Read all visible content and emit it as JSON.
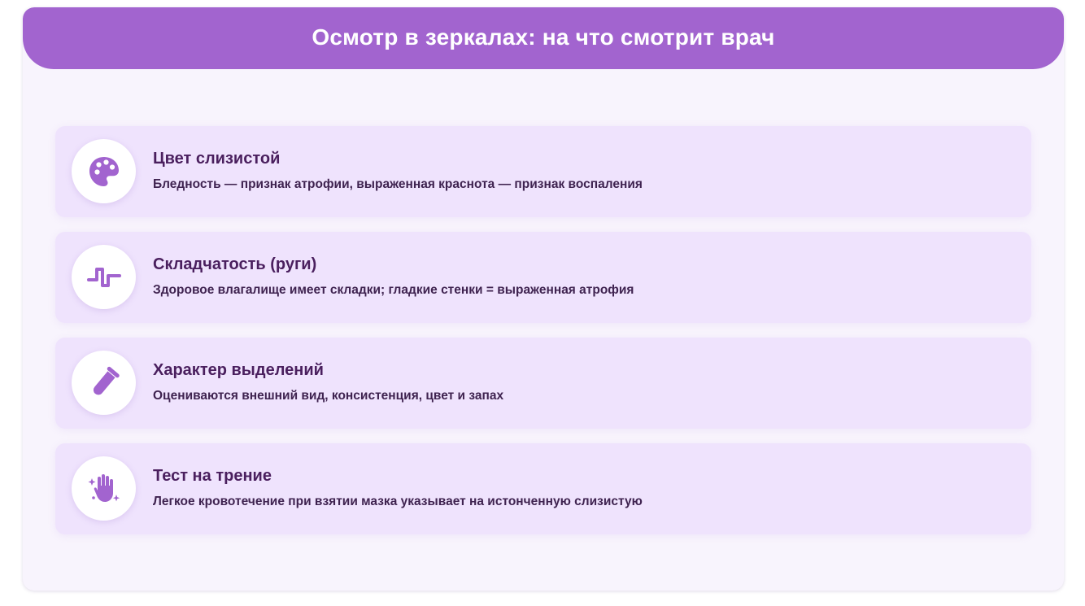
{
  "header": {
    "title": "Осмотр в зеркалах: на что смотрит врач"
  },
  "colors": {
    "accent": "#a264cf",
    "card_background": "#f8f4fd",
    "item_background": "#efe3fd",
    "title_text": "#4a1f5e",
    "icon": "#a264cf"
  },
  "items": [
    {
      "icon": "palette-icon",
      "title": "Цвет слизистой",
      "description": "Бледность — признак атрофии, выраженная краснота — признак воспаления"
    },
    {
      "icon": "wave-icon",
      "title": "Складчатость (руги)",
      "description": "Здоровое влагалище имеет складки; гладкие стенки = выраженная атрофия"
    },
    {
      "icon": "test-tube-icon",
      "title": "Характер выделений",
      "description": "Оцениваются внешний вид, консистенция, цвет и запах"
    },
    {
      "icon": "hand-sparkles-icon",
      "title": "Тест на трение",
      "description": "Легкое кровотечение при взятии мазка указывает на истонченную слизистую"
    }
  ]
}
